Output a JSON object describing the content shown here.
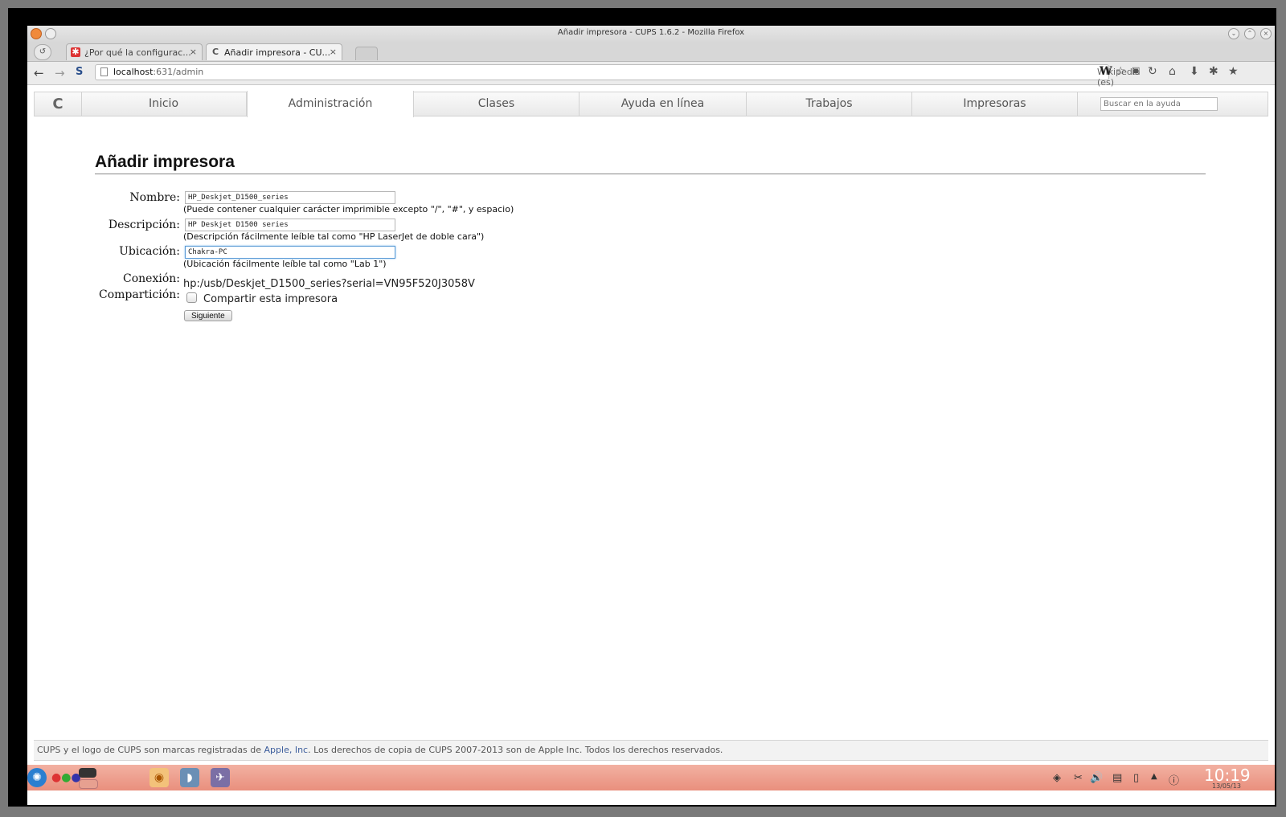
{
  "window": {
    "title": "Añadir impresora - CUPS 1.6.2 - Mozilla Firefox"
  },
  "tabs": [
    {
      "label": "¿Por qué la configurac...",
      "close": "×"
    },
    {
      "label": "Añadir impresora - CU...",
      "close": "×"
    }
  ],
  "nav": {
    "url_host": "localhost",
    "url_path": ":631/admin",
    "search_engine": "Wikipedia (es)"
  },
  "cups_nav": {
    "logo": "C",
    "tabs": [
      "Inicio",
      "Administración",
      "Clases",
      "Ayuda en línea",
      "Trabajos",
      "Impresoras"
    ],
    "active_tab": "Administración",
    "search_placeholder": "Buscar en la ayuda"
  },
  "form": {
    "title": "Añadir impresora",
    "name_label": "Nombre:",
    "name_value": "HP_Deskjet_D1500_series",
    "name_hint": "(Puede contener cualquier carácter imprimible excepto \"/\", \"#\", y espacio)",
    "desc_label": "Descripción:",
    "desc_value": "HP Deskjet D1500 series",
    "desc_hint": "(Descripción fácilmente leíble tal como \"HP LaserJet de doble cara\")",
    "loc_label": "Ubicación:",
    "loc_value": "Chakra-PC",
    "loc_hint": "(Ubicación fácilmente leíble tal como \"Lab 1\")",
    "conn_label": "Conexión:",
    "conn_value": "hp:/usb/Deskjet_D1500_series?serial=VN95F520J3058V",
    "share_label": "Compartición:",
    "share_checkbox_label": "Compartir esta impresora",
    "share_checked": false,
    "submit_label": "Siguiente"
  },
  "footer": {
    "text_before": "CUPS y el logo de CUPS son marcas registradas de ",
    "link_text": "Apple, Inc",
    "text_after": ". Los derechos de copia de CUPS 2007-2013 son de Apple Inc. Todos los derechos reservados."
  },
  "taskbar": {
    "clock": "10:19",
    "date": "13/05/13"
  },
  "colors": {
    "taskbar": "#e98f7d",
    "focus": "#5b9bd5",
    "link": "#3c5d9c"
  }
}
